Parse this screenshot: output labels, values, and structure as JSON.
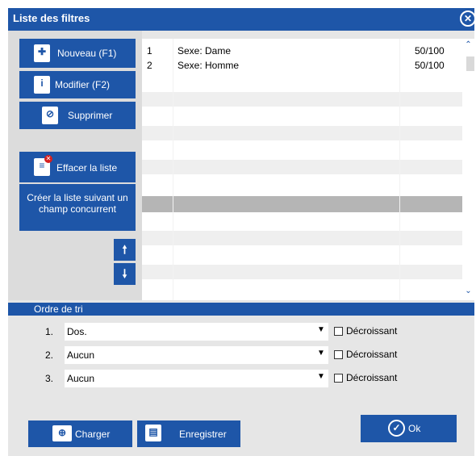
{
  "window": {
    "title": "Liste des filtres"
  },
  "left": {
    "new": "Nouveau (F1)",
    "modify": "Modifier (F2)",
    "delete": "Supprimer",
    "clear": "Effacer la liste",
    "create": "Créer la liste suivant un champ concurrent"
  },
  "list": {
    "rows": [
      {
        "num": "1",
        "label": "Sexe: Dame",
        "value": "50/100"
      },
      {
        "num": "2",
        "label": "Sexe: Homme",
        "value": "50/100"
      }
    ]
  },
  "sort": {
    "header": "Ordre de tri",
    "rows": [
      {
        "num": "1.",
        "field": "Dos.",
        "desc": "Décroissant"
      },
      {
        "num": "2.",
        "field": "Aucun",
        "desc": "Décroissant"
      },
      {
        "num": "3.",
        "field": "Aucun",
        "desc": "Décroissant"
      }
    ]
  },
  "footer": {
    "load": "Charger",
    "save": "Enregistrer",
    "ok": "Ok"
  }
}
